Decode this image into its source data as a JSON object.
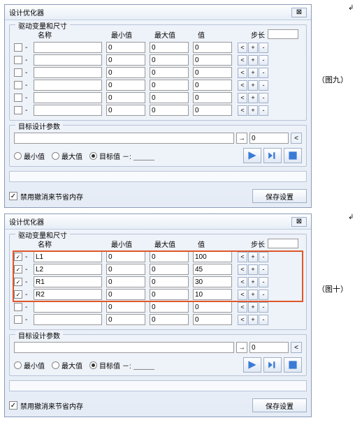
{
  "dialog_title": "设计优化器",
  "close_glyph": "⊠",
  "group_vars": "驱动变量和尺寸",
  "group_target": "目标设计参数",
  "headers": {
    "name": "名称",
    "min": "最小值",
    "max": "最大值",
    "val": "值",
    "step": "步长"
  },
  "rows1": [
    {
      "checked": false,
      "name": "",
      "min": "0",
      "max": "0",
      "val": "0"
    },
    {
      "checked": false,
      "name": "",
      "min": "0",
      "max": "0",
      "val": "0"
    },
    {
      "checked": false,
      "name": "",
      "min": "0",
      "max": "0",
      "val": "0"
    },
    {
      "checked": false,
      "name": "",
      "min": "0",
      "max": "0",
      "val": "0"
    },
    {
      "checked": false,
      "name": "",
      "min": "0",
      "max": "0",
      "val": "0"
    },
    {
      "checked": false,
      "name": "",
      "min": "0",
      "max": "0",
      "val": "0"
    }
  ],
  "rows2": [
    {
      "checked": true,
      "name": "L1",
      "min": "0",
      "max": "0",
      "val": "100"
    },
    {
      "checked": true,
      "name": "L2",
      "min": "0",
      "max": "0",
      "val": "45"
    },
    {
      "checked": true,
      "name": "R1",
      "min": "0",
      "max": "0",
      "val": "30"
    },
    {
      "checked": true,
      "name": "R2",
      "min": "0",
      "max": "0",
      "val": "10"
    },
    {
      "checked": false,
      "name": "",
      "min": "0",
      "max": "0",
      "val": "0"
    },
    {
      "checked": false,
      "name": "",
      "min": "0",
      "max": "0",
      "val": "0"
    }
  ],
  "btns": {
    "lt": "<",
    "plus": "+",
    "minus": "-"
  },
  "arrow_glyph": "→",
  "angle_glyph": "<",
  "target_zero": "0",
  "radios": {
    "min": "最小值",
    "max": "最大值",
    "target": "目标值",
    "targetSep": "－:"
  },
  "memory_flag": "禁用撤消来节省内存",
  "save": "保存设置",
  "check_glyph": "✓",
  "fig9": "（图九）",
  "fig10": "（图十）",
  "arrow_note": "↲"
}
